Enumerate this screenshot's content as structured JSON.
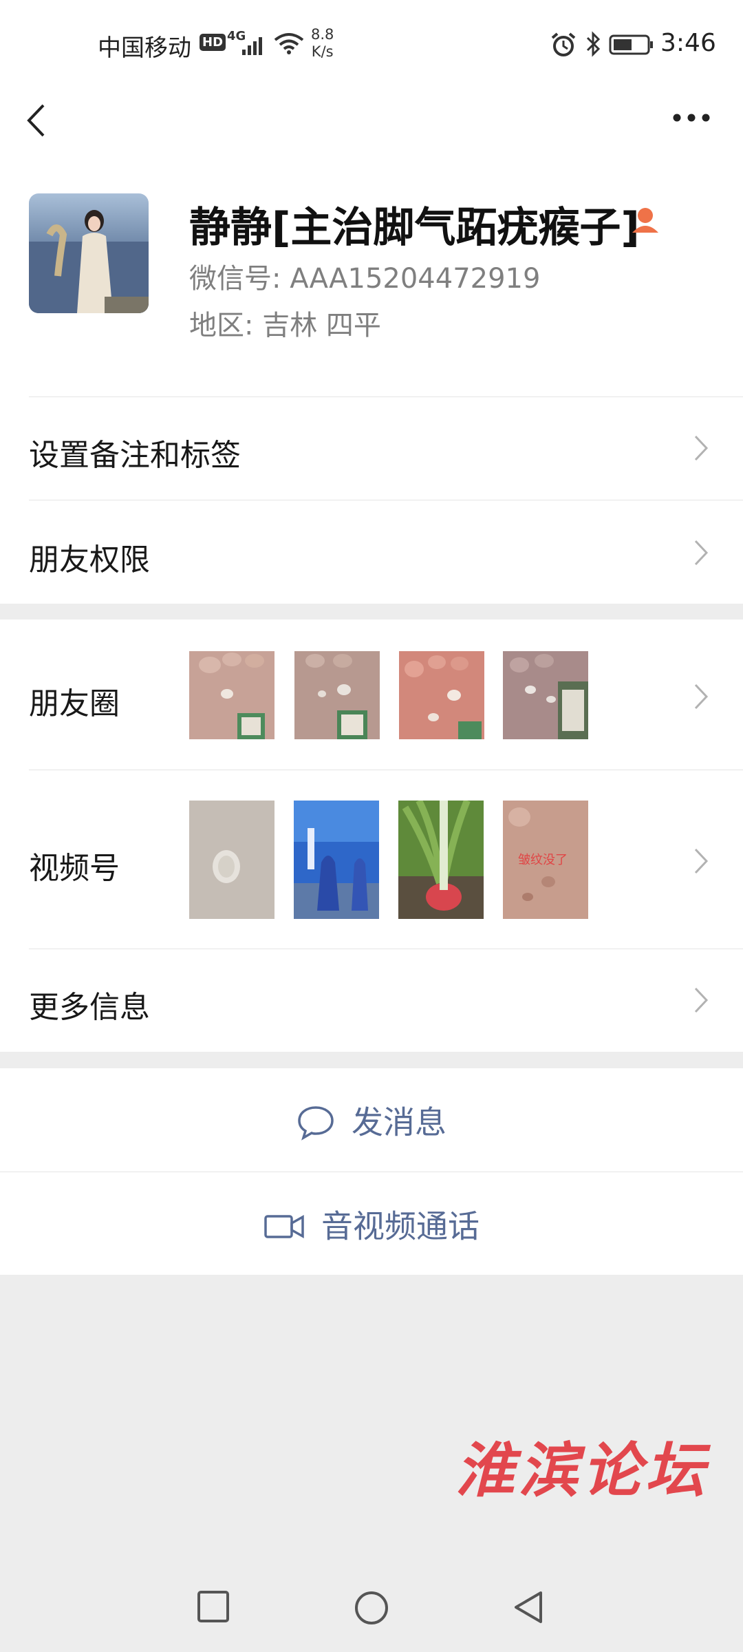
{
  "status_bar": {
    "carrier": "中国移动",
    "hd": "HD",
    "network": "4G",
    "speed_value": "8.8",
    "speed_unit": "K/s",
    "time": "3:46"
  },
  "profile": {
    "name": "静静[主治脚气跖疣瘊子]",
    "wechat_id": "微信号:  AAA15204472919",
    "region": "地区:  吉林  四平"
  },
  "cells": {
    "remark": "设置备注和标签",
    "permissions": "朋友权限",
    "moments": "朋友圈",
    "channels": "视频号",
    "more_info": "更多信息"
  },
  "channels_thumb_caption": "皱纹没了",
  "actions": {
    "message": "发消息",
    "call": "音视频通话"
  },
  "watermark": "淮滨论坛",
  "colors": {
    "link_blue": "#576b95",
    "badge_orange": "#ef7248",
    "watermark_red": "#e2474d",
    "background_gray": "#ededed"
  }
}
